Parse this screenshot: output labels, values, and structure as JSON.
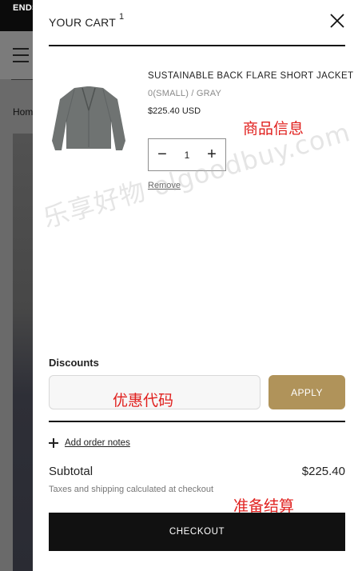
{
  "background": {
    "announcement": "ENDS",
    "breadcrumb": "Home"
  },
  "cart": {
    "title": "YOUR CART",
    "count": "1",
    "close_icon": "close-icon"
  },
  "item": {
    "title": "SUSTAINABLE BACK FLARE SHORT JACKET",
    "variant": "0(SMALL) / GRAY",
    "price": "$225.40 USD",
    "quantity": "1",
    "minus_symbol": "−",
    "plus_symbol": "+",
    "remove_label": "Remove",
    "image_icon": "jacket-image"
  },
  "discounts": {
    "label": "Discounts",
    "placeholder": "",
    "apply_label": "APPLY"
  },
  "notes": {
    "label": "Add order notes"
  },
  "summary": {
    "subtotal_label": "Subtotal",
    "subtotal_value": "$225.40",
    "tax_note": "Taxes and shipping calculated at checkout",
    "checkout_label": "CHECKOUT"
  },
  "annotations": {
    "product_info": "商品信息",
    "coupon_code": "优惠代码",
    "ready_checkout": "准备结算",
    "watermark": "乐享好物 olgoodbuy.com"
  },
  "colors": {
    "accent": "#b0935a",
    "checkout": "#111111",
    "annotation": "#e0201e"
  }
}
